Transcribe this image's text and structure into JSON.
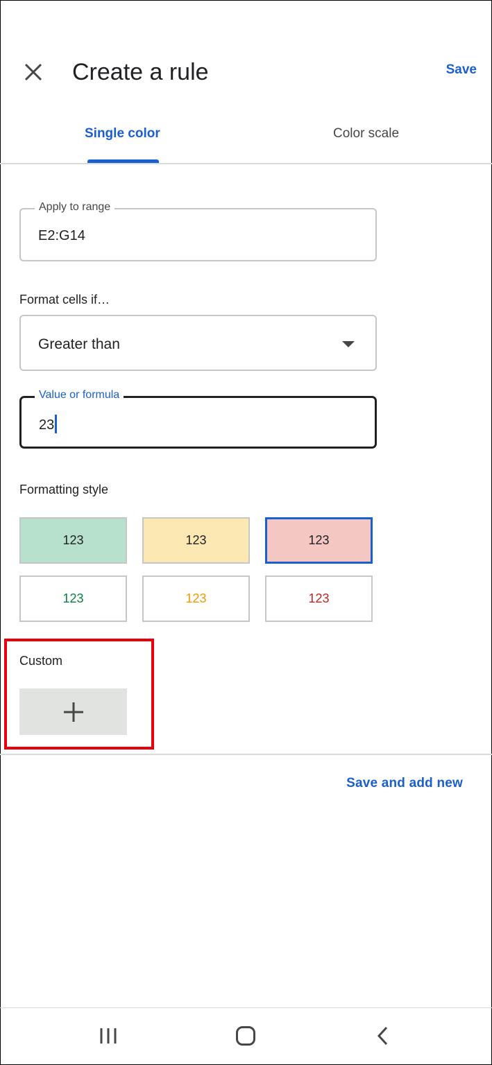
{
  "header": {
    "close_icon": "close-icon",
    "title": "Create a rule",
    "save_label": "Save"
  },
  "tabs": [
    {
      "label": "Single color",
      "active": true
    },
    {
      "label": "Color scale",
      "active": false
    }
  ],
  "range_field": {
    "label": "Apply to range",
    "value": "E2:G14"
  },
  "condition": {
    "label": "Format cells if…",
    "selected": "Greater than",
    "icon": "dropdown-arrow-icon"
  },
  "formula_field": {
    "label": "Value or formula",
    "value": "23"
  },
  "formatting_style": {
    "label": "Formatting style",
    "swatches": [
      {
        "text": "123",
        "background": "#b7e1cd",
        "color": "#202124",
        "selected": false
      },
      {
        "text": "123",
        "background": "#fce8b2",
        "color": "#202124",
        "selected": false
      },
      {
        "text": "123",
        "background": "#f4c7c3",
        "color": "#202124",
        "selected": true
      },
      {
        "text": "123",
        "background": "#ffffff",
        "color": "#0b8043",
        "selected": false
      },
      {
        "text": "123",
        "background": "#ffffff",
        "color": "#f29900",
        "selected": false
      },
      {
        "text": "123",
        "background": "#ffffff",
        "color": "#c5221f",
        "selected": false
      }
    ]
  },
  "custom": {
    "label": "Custom",
    "add_icon": "plus-icon",
    "highlight_color": "#e8000b"
  },
  "footer": {
    "save_and_add_label": "Save and add new"
  },
  "system_nav": {
    "buttons": [
      "recent-apps-icon",
      "home-icon",
      "back-icon"
    ]
  },
  "colors": {
    "accent": "#1a5fd0",
    "divider": "#d9d9d9"
  }
}
